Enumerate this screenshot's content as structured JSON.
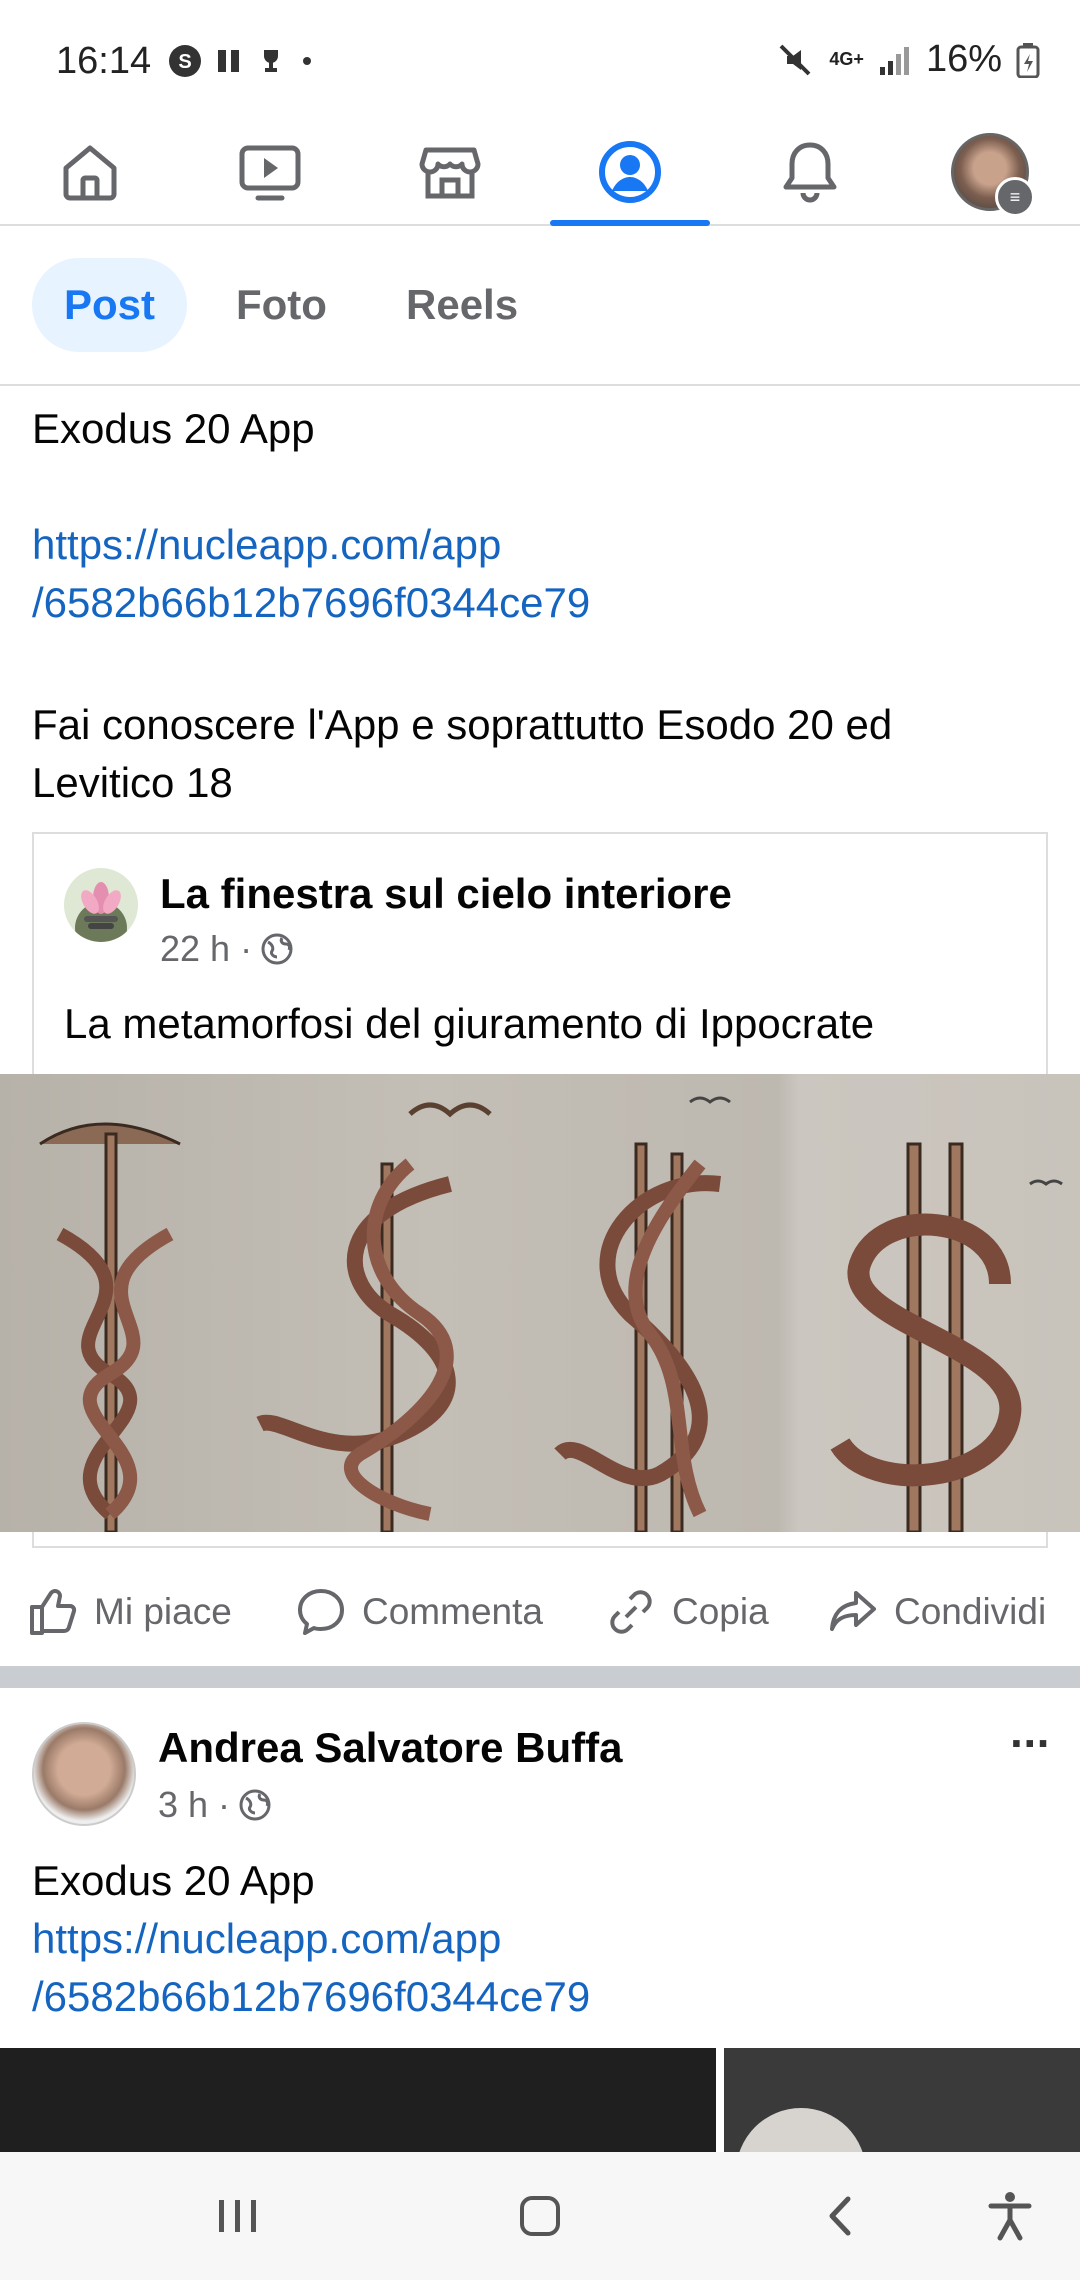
{
  "status_bar": {
    "time": "16:14",
    "battery_percent": "16%",
    "network": "4G+"
  },
  "nav": {
    "items": [
      {
        "name": "home-icon"
      },
      {
        "name": "video-icon"
      },
      {
        "name": "marketplace-icon"
      },
      {
        "name": "profile-icon",
        "active": true
      },
      {
        "name": "notifications-icon"
      },
      {
        "name": "menu-avatar-icon"
      }
    ],
    "accent": "#1877f2"
  },
  "tabs": [
    {
      "label": "Post",
      "active": true
    },
    {
      "label": "Foto"
    },
    {
      "label": "Reels"
    }
  ],
  "post1": {
    "title_line": "Exodus 20 App",
    "link_line1": "https://nucleapp.com/app",
    "link_line2": "/6582b66b12b7696f0344ce79",
    "text_line1": "Fai conoscere l'App e soprattutto Esodo 20 ed",
    "text_line2": "Levitico 18",
    "shared": {
      "page_name": "La finestra sul cielo interiore",
      "time": "22 h ·",
      "body": "La metamorfosi del giuramento di Ippocrate"
    },
    "actions": {
      "like": "Mi piace",
      "comment": "Commenta",
      "copy": "Copia",
      "share": "Condividi"
    }
  },
  "post2": {
    "author": "Andrea Salvatore Buffa",
    "time": "3 h ·",
    "title_line": "Exodus 20 App",
    "link_line1": "https://nucleapp.com/app",
    "link_line2": "/6582b66b12b7696f0344ce79",
    "more": "···"
  }
}
